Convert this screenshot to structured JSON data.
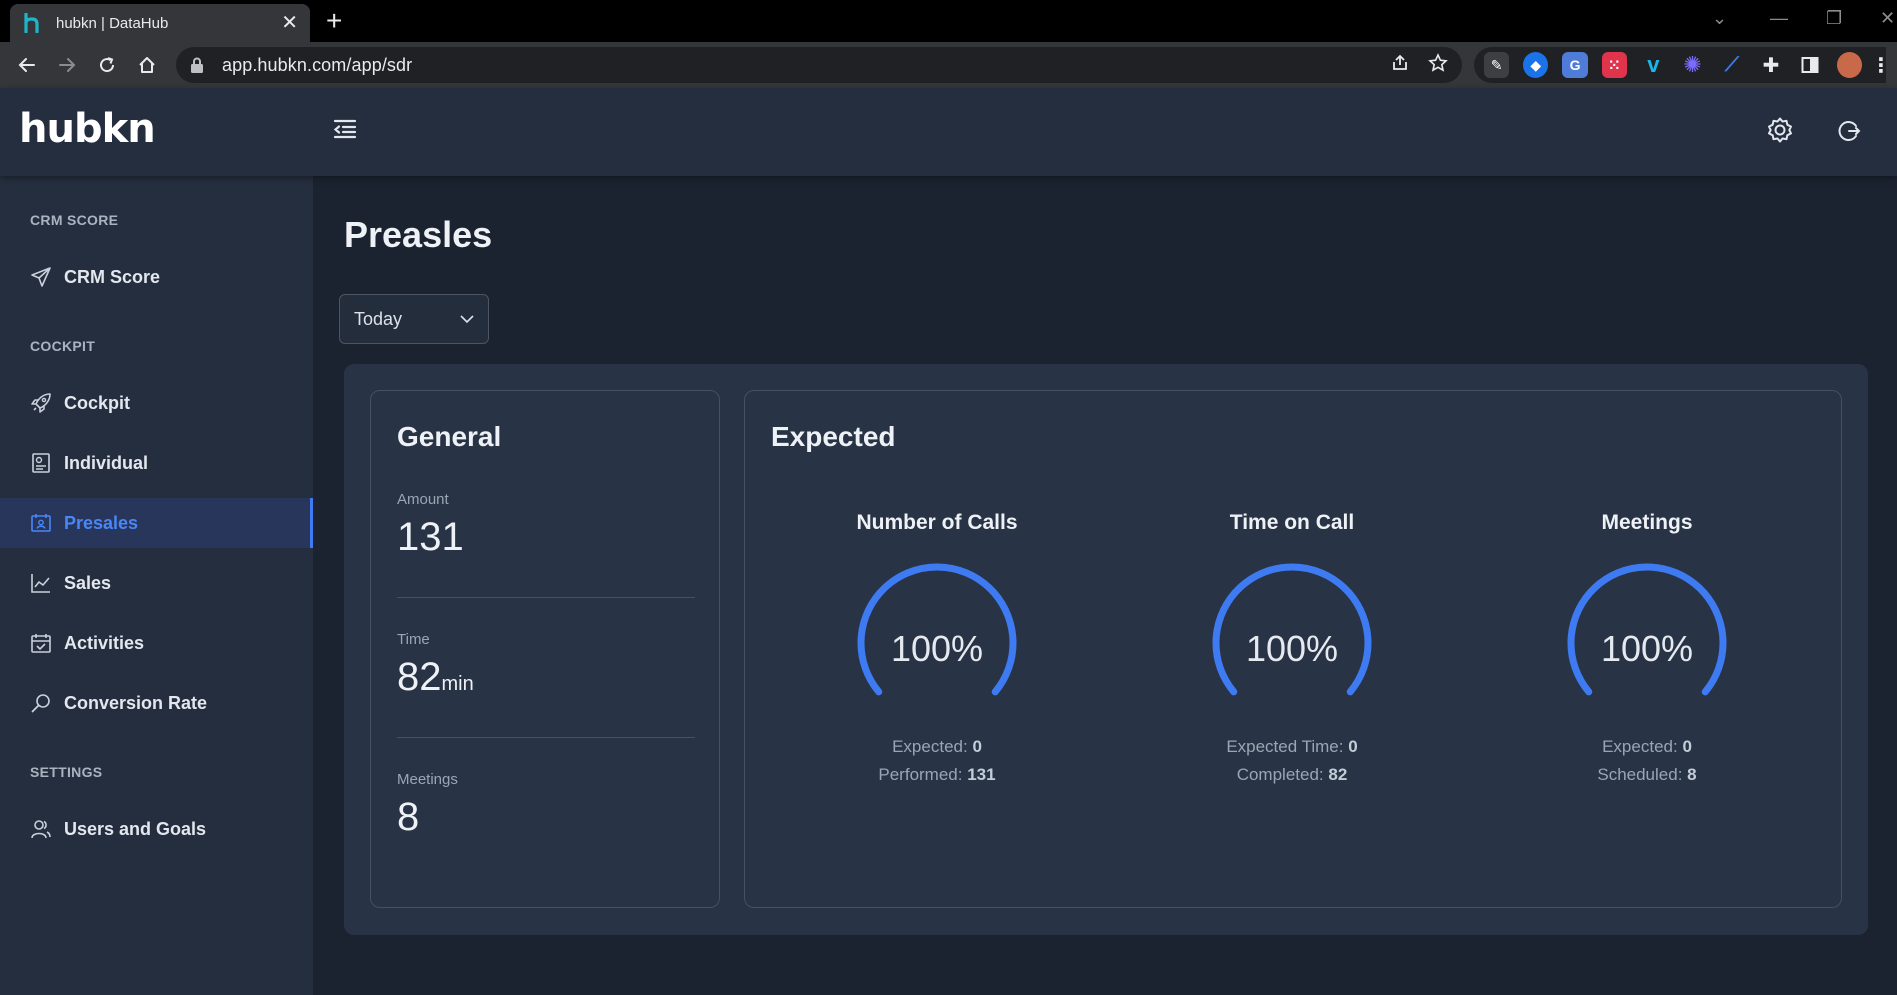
{
  "browser": {
    "tab_title": "hubkn | DataHub",
    "url": "app.hubkn.com/app/sdr"
  },
  "app": {
    "logo_text": "hubkn",
    "accent_color": "#3e7bf2"
  },
  "sidebar": {
    "sections": [
      {
        "title": "CRM SCORE"
      },
      {
        "title": "COCKPIT"
      },
      {
        "title": "SETTINGS"
      }
    ],
    "items": [
      {
        "label": "CRM Score",
        "icon": "send-icon"
      },
      {
        "label": "Cockpit",
        "icon": "rocket-icon"
      },
      {
        "label": "Individual",
        "icon": "user-file-icon"
      },
      {
        "label": "Presales",
        "icon": "id-card-icon",
        "active": true
      },
      {
        "label": "Sales",
        "icon": "chart-line-icon"
      },
      {
        "label": "Activities",
        "icon": "calendar-check-icon"
      },
      {
        "label": "Conversion Rate",
        "icon": "magnifier-icon"
      },
      {
        "label": "Users and Goals",
        "icon": "users-icon"
      }
    ]
  },
  "main": {
    "title": "Preasles",
    "period": {
      "selected": "Today"
    },
    "general": {
      "title": "General",
      "stats": [
        {
          "label": "Amount",
          "value": "131",
          "unit": ""
        },
        {
          "label": "Time",
          "value": "82",
          "unit": "min"
        },
        {
          "label": "Meetings",
          "value": "8",
          "unit": ""
        }
      ]
    },
    "expected": {
      "title": "Expected",
      "gauges": [
        {
          "title": "Number of Calls",
          "percent_text": "100%",
          "fill": 1.0,
          "line1_label": "Expected:",
          "line1_value": "0",
          "line2_label": "Performed:",
          "line2_value": "131"
        },
        {
          "title": "Time on Call",
          "percent_text": "100%",
          "fill": 1.0,
          "line1_label": "Expected Time:",
          "line1_value": "0",
          "line2_label": "Completed:",
          "line2_value": "82"
        },
        {
          "title": "Meetings",
          "percent_text": "100%",
          "fill": 1.0,
          "line1_label": "Expected:",
          "line1_value": "0",
          "line2_label": "Scheduled:",
          "line2_value": "8"
        }
      ]
    }
  }
}
